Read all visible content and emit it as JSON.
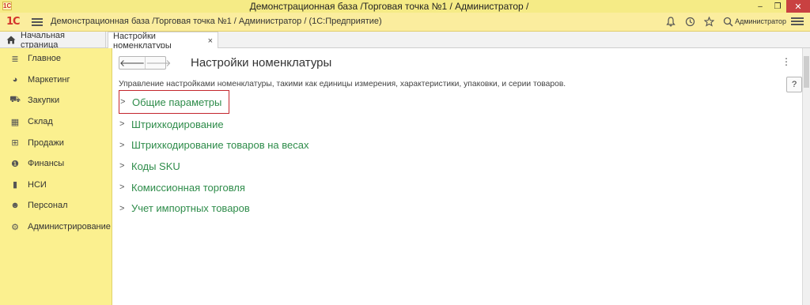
{
  "window": {
    "title": "Демонстрационная база /Торговая точка №1 / Администратор /",
    "app_icon": "1c-app-icon",
    "controls": {
      "minimize": "–",
      "restore": "❐",
      "close": "✕"
    }
  },
  "header": {
    "logo": "1С",
    "title": "Демонстрационная база /Торговая точка №1 / Администратор /  (1С:Предприятие)",
    "icons": [
      "bell-icon",
      "history-icon",
      "star-icon",
      "search-icon"
    ],
    "user": "Администратор"
  },
  "tabs": {
    "home_label": "Начальная страница",
    "active_label": "Настройки номенклатуры",
    "close_glyph": "×"
  },
  "sidebar": {
    "items": [
      {
        "label": "Главное",
        "icon": "menu-icon",
        "glyph": "≣"
      },
      {
        "label": "Маркетинг",
        "icon": "pie-chart-icon",
        "glyph": "◕"
      },
      {
        "label": "Закупки",
        "icon": "cart-icon",
        "glyph": "⛟"
      },
      {
        "label": "Склад",
        "icon": "warehouse-icon",
        "glyph": "▦"
      },
      {
        "label": "Продажи",
        "icon": "basket-icon",
        "glyph": "⊞"
      },
      {
        "label": "Финансы",
        "icon": "finance-icon",
        "glyph": "❶"
      },
      {
        "label": "НСИ",
        "icon": "book-icon",
        "glyph": "▮"
      },
      {
        "label": "Персонал",
        "icon": "person-icon",
        "glyph": "☻"
      },
      {
        "label": "Администрирование",
        "icon": "gear-icon",
        "glyph": "⚙"
      }
    ]
  },
  "main": {
    "back_glyph": "🡐",
    "forward_glyph": "🡒",
    "title": "Настройки номенклатуры",
    "more_glyph": "⋮",
    "help_glyph": "?",
    "description": "Управление настройками номенклатуры, такими как единицы измерения, характеристики, упаковки, и серии товаров.",
    "chevron": ">",
    "sections": [
      "Общие параметры",
      "Штрихкодирование",
      "Штрихкодирование товаров на весах",
      "Коды SKU",
      "Комиссионная торговля",
      "Учет импортных товаров"
    ]
  },
  "colors": {
    "sidebar_bg": "#fbf08f",
    "header_bg": "#fbed9e",
    "link_green": "#2e8c4a",
    "highlight_red": "#c4262d"
  }
}
